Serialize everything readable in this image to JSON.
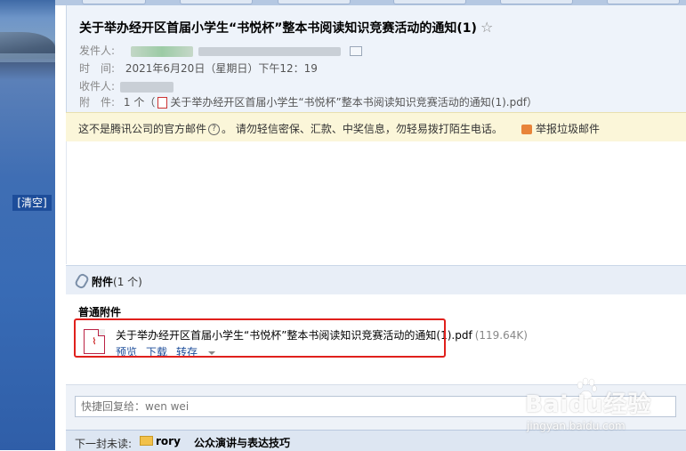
{
  "sidebar": {
    "clear_label": "[清空]"
  },
  "email": {
    "subject": "关于举办经开区首届小学生“书悦杯”整本书阅读知识竞赛活动的通知(1)",
    "star": "☆",
    "from_label": "发件人:",
    "time_label": "时　间:",
    "time_value": "2021年6月20日（星期日）下午12：19",
    "to_label": "收件人:",
    "attach_label": "附　件:",
    "attach_summary_prefix": "1 个（",
    "attach_summary_name": "关于举办经开区首届小学生“书悦杯”整本书阅读知识竞赛活动的通知(1).pdf）"
  },
  "notice": {
    "text_before": "这不是腾讯公司的官方邮件",
    "help_glyph": "?",
    "text_after": "。 请勿轻信密保、汇款、中奖信息，勿轻易拨打陌生电话。",
    "report_label": "举报垃圾邮件"
  },
  "attachments": {
    "title": "附件",
    "count": "(1 个)",
    "section_label": "普通附件",
    "file": {
      "name": "关于举办经开区首届小学生“书悦杯”整本书阅读知识竞赛活动的通知(1).pdf",
      "size": "(119.64K)",
      "preview_label": "预览",
      "download_label": "下载",
      "transfer_label": "转存"
    }
  },
  "reply": {
    "placeholder": "快捷回复给：wen wei"
  },
  "next_mail": {
    "label": "下一封未读:",
    "sender": "rory",
    "subject": "公众演讲与表达技巧"
  },
  "watermark": {
    "brand": "Baidu经验",
    "url": "jingyan.baidu.com"
  },
  "colors": {
    "highlight": "#e0201c",
    "header_bg": "#eef3fa",
    "notice_bg": "#fbf6d9",
    "link": "#1d4d9a"
  }
}
